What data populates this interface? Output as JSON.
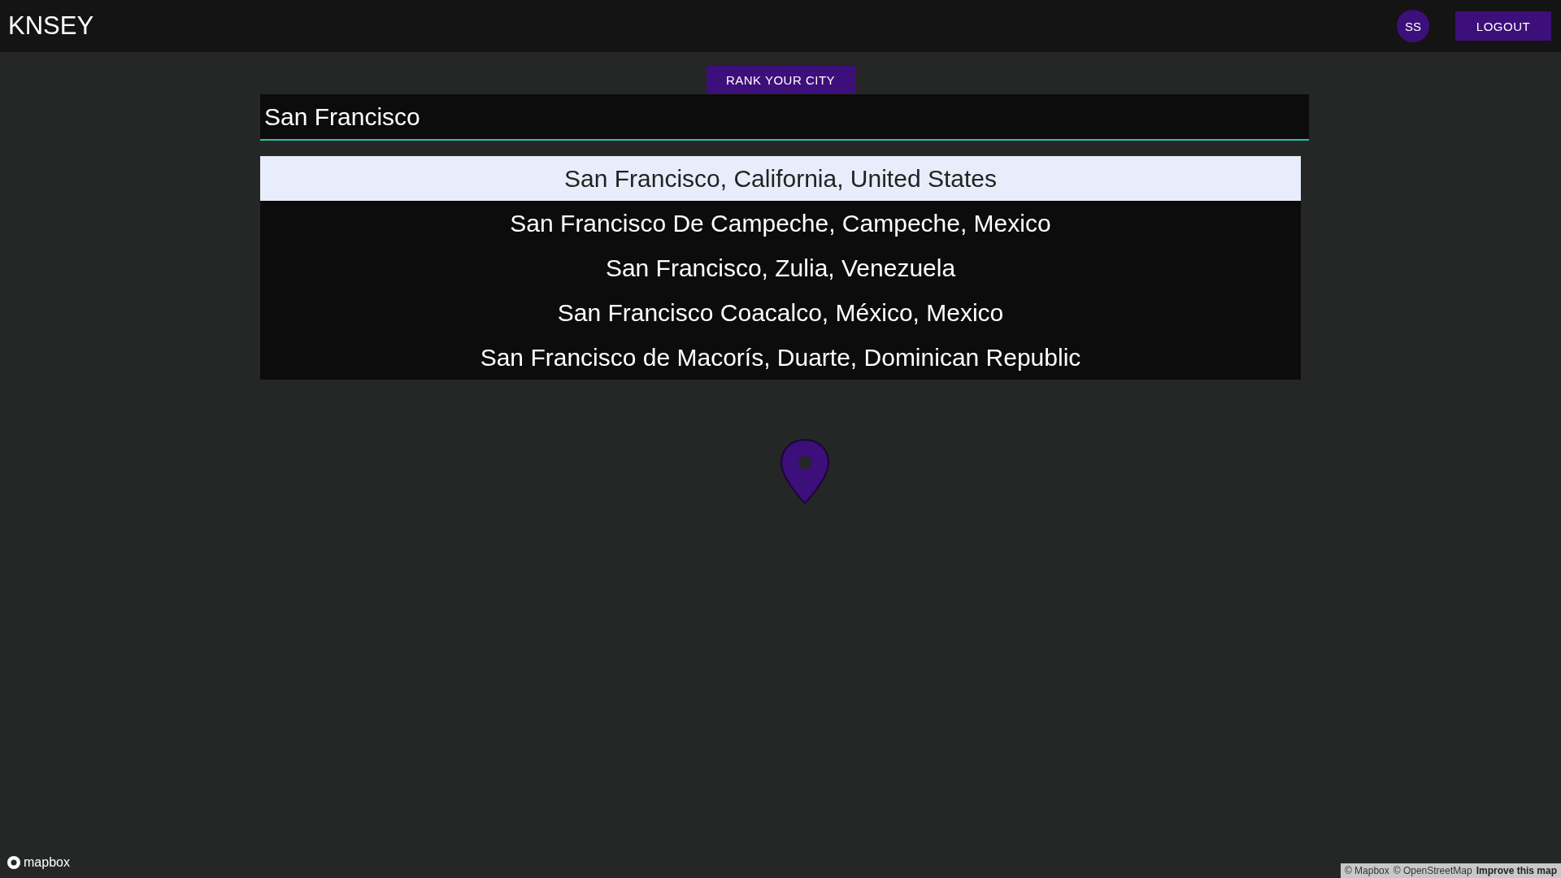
{
  "header": {
    "brand": "KNSEY",
    "avatar_initials": "SS",
    "logout": "LOGOUT"
  },
  "rank_button": "RANK YOUR CITY",
  "search": {
    "value": "San Francisco"
  },
  "suggestions": [
    {
      "label": "San Francisco, California, United States",
      "selected": true
    },
    {
      "label": "San Francisco De Campeche, Campeche, Mexico",
      "selected": false
    },
    {
      "label": "San Francisco, Zulia, Venezuela",
      "selected": false
    },
    {
      "label": "San Francisco Coacalco, México, Mexico",
      "selected": false
    },
    {
      "label": "San Francisco de Macorís, Duarte, Dominican Republic",
      "selected": false
    }
  ],
  "map": {
    "logo": "mapbox",
    "attribution": [
      "© Mapbox",
      "© OpenStreetMap"
    ],
    "improve_link": "Improve this map"
  }
}
